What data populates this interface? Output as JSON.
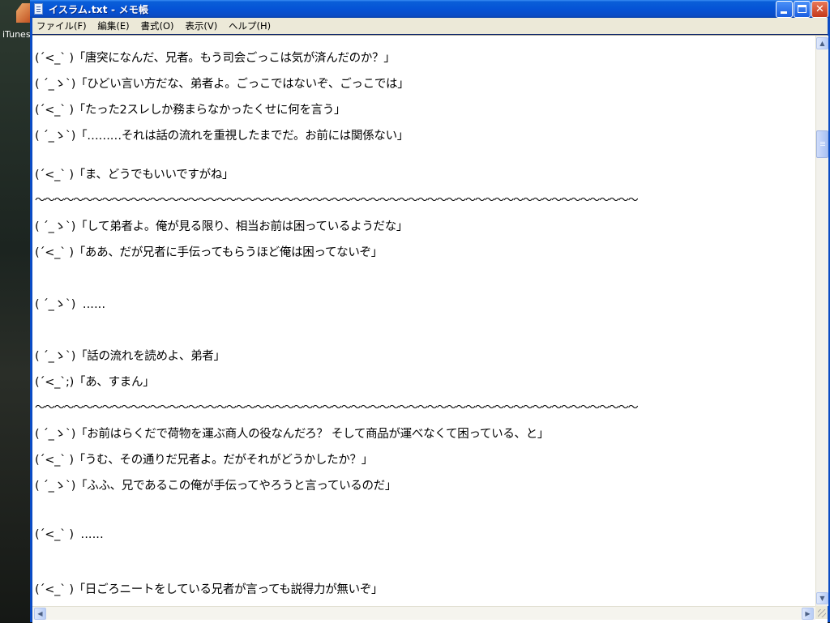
{
  "desktop": {
    "icon_label": "iTunes"
  },
  "window": {
    "title": "イスラム.txt - メモ帳",
    "min_glyph": "",
    "max_glyph": "",
    "close_glyph": "✕"
  },
  "menu": [
    "ファイル(F)",
    "編集(E)",
    "書式(O)",
    "表示(V)",
    "ヘルプ(H)"
  ],
  "document": {
    "lines": [
      "(´<_` )「唐突になんだ、兄者。もう司会ごっこは気が済んだのか？」",
      "( ´_ゝ`)「ひどい言い方だな、弟者よ。ごっこではないぞ、ごっこでは」",
      "(´<_` )「たった2スレしか務まらなかったくせに何を言う」",
      "( ´_ゝ`)「………それは話の流れを重視したまでだ。お前には関係ない」",
      "(´<_` )「ま、どうでもいいですがね」",
      "〜〜〜〜〜〜〜〜〜〜〜〜〜〜〜〜〜〜〜〜〜〜〜〜〜〜〜〜〜〜〜〜〜〜〜〜〜〜〜〜〜〜〜〜〜〜〜〜〜〜〜〜〜〜〜〜〜〜〜〜〜〜〜",
      "( ´_ゝ`)「して弟者よ。俺が見る限り、相当お前は困っているようだな」",
      "(´<_` )「ああ、だが兄者に手伝ってもらうほど俺は困ってないぞ」",
      "( ´_ゝ`)  ‥‥‥",
      "( ´_ゝ`)「話の流れを読めよ、弟者」",
      "(´<_`;)「あ、すまん」",
      "〜〜〜〜〜〜〜〜〜〜〜〜〜〜〜〜〜〜〜〜〜〜〜〜〜〜〜〜〜〜〜〜〜〜〜〜〜〜〜〜〜〜〜〜〜〜〜〜〜〜〜〜〜〜〜〜〜〜〜〜〜〜〜",
      "( ´_ゝ`)「お前はらくだで荷物を運ぶ商人の役なんだろ？ そして商品が運べなくて困っている、と」",
      "(´<_` )「うむ、その通りだ兄者よ。だがそれがどうかしたか？」",
      "( ´_ゝ`)「ふふ、兄であるこの俺が手伝ってやろうと言っているのだ」",
      "(´<_` )  ‥‥‥",
      "(´<_` )「日ごろニートをしている兄者が言っても説得力が無いぞ」"
    ]
  },
  "icons": {
    "up": "▲",
    "down": "▼",
    "left": "◀",
    "right": "▶"
  }
}
